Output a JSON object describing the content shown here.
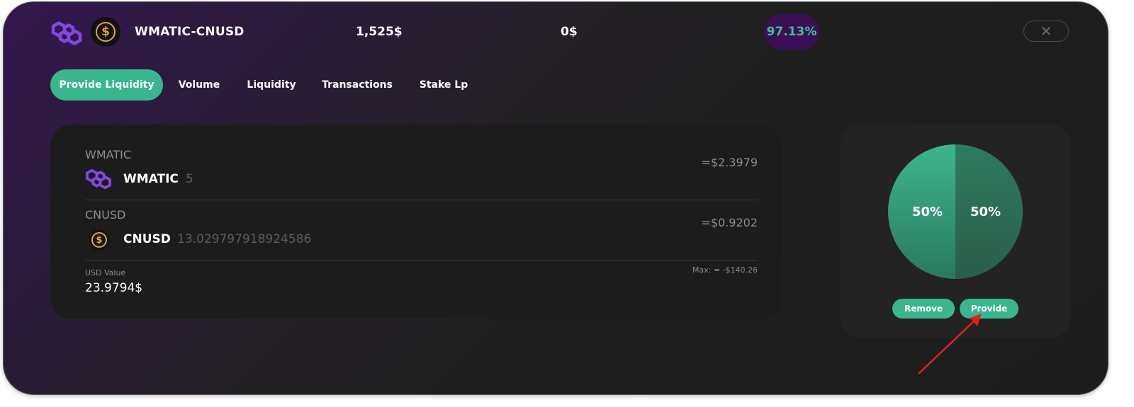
{
  "header": {
    "pair": "WMATIC-CNUSD",
    "liquidity": "1,525$",
    "volume": "0$",
    "apr": "97.13%",
    "close_icon": "close-icon"
  },
  "tabs": [
    {
      "label": "Provide Liquidity",
      "active": true
    },
    {
      "label": "Volume",
      "active": false
    },
    {
      "label": "Liquidity",
      "active": false
    },
    {
      "label": "Transactions",
      "active": false
    },
    {
      "label": "Stake Lp",
      "active": false
    }
  ],
  "form": {
    "token_a": {
      "label": "WMATIC",
      "name": "WMATIC",
      "amount": "5",
      "usd": "=$2.3979",
      "icon": "polygon-icon"
    },
    "token_b": {
      "label": "CNUSD",
      "name": "CNUSD",
      "amount": "13.029797918924586",
      "usd": "=$0.9202",
      "icon": "dollar-coin-icon",
      "coin_symbol": "$"
    },
    "usd_value_label": "USD Value",
    "usd_value": "23.9794$",
    "max_text": "Max: = -$140.26"
  },
  "ratio": {
    "left_label": "50%",
    "right_label": "50%",
    "remove_label": "Remove",
    "provide_label": "Provide"
  },
  "colors": {
    "accent": "#3ab68f",
    "apr_bg": "#3a0f55",
    "coin_gold": "#e3a428",
    "polygon_purple": "#8247e5",
    "pie_left": "#38a882",
    "pie_right": "#2e735a",
    "annotation_arrow": "#e02020"
  }
}
